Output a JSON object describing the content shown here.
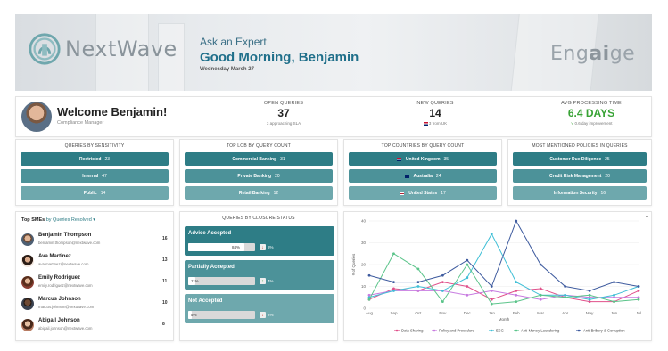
{
  "header": {
    "logo_text": "NextWave",
    "ask_label": "Ask an Expert",
    "greeting": "Good Morning, Benjamin",
    "date": "Wednesday March 27",
    "brand_right_pre": "Eng",
    "brand_right_ai": "ai",
    "brand_right_post": "ge"
  },
  "welcome": {
    "title": "Welcome Benjamin!",
    "role": "Compliance Manager"
  },
  "kpis": {
    "open": {
      "label": "OPEN QUERIES",
      "value": "37",
      "sub": "3 approaching SLA"
    },
    "new": {
      "label": "NEW QUERIES",
      "value": "14",
      "sub": "3 from UK"
    },
    "avg": {
      "label": "AVG PROCESSING TIME",
      "value": "6.4 DAYS",
      "sub": "0.6 day improvement"
    }
  },
  "sensitivity": {
    "title": "QUERIES BY SENSITIVITY",
    "items": [
      {
        "label": "Restricted",
        "count": "23"
      },
      {
        "label": "Internal",
        "count": "47"
      },
      {
        "label": "Public",
        "count": "14"
      }
    ]
  },
  "lob": {
    "title": "TOP LOB BY QUERY COUNT",
    "items": [
      {
        "label": "Commercial Banking",
        "count": "31"
      },
      {
        "label": "Private Banking",
        "count": "20"
      },
      {
        "label": "Retail Banking",
        "count": "12"
      }
    ]
  },
  "countries": {
    "title": "TOP COUNTRIES BY QUERY COUNT",
    "items": [
      {
        "label": "United Kingdom",
        "count": "35"
      },
      {
        "label": "Australia",
        "count": "24"
      },
      {
        "label": "United States",
        "count": "17"
      }
    ]
  },
  "policies": {
    "title": "MOST MENTIONED POLICIES IN QUERIES",
    "items": [
      {
        "label": "Customer Due Diligence",
        "count": "25"
      },
      {
        "label": "Credit Risk Management",
        "count": "20"
      },
      {
        "label": "Information Security",
        "count": "16"
      }
    ]
  },
  "smes": {
    "title": "Top SMEs",
    "by": "by Queries Resolved",
    "items": [
      {
        "name": "Benjamin Thompson",
        "email": "benjamin.thompson@nextwave.com",
        "count": "16"
      },
      {
        "name": "Ava Martinez",
        "email": "ava.martinez@nextwave.com",
        "count": "13"
      },
      {
        "name": "Emily Rodriguez",
        "email": "emily.rodriguez@nextwave.com",
        "count": "11"
      },
      {
        "name": "Marcus Johnson",
        "email": "marcus.johnson@nextwave.com",
        "count": "10"
      },
      {
        "name": "Abigail Johnson",
        "email": "abigail.johnson@nextwave.com",
        "count": "8"
      }
    ]
  },
  "closure": {
    "title": "QUERIES BY CLOSURE STATUS",
    "items": [
      {
        "label": "Advice Accepted",
        "percent": 84,
        "percent_text": "84%",
        "change": "8%"
      },
      {
        "label": "Partially Accepted",
        "percent": 11,
        "percent_text": "11%",
        "change": "4%"
      },
      {
        "label": "Not Accepted",
        "percent": 5,
        "percent_text": "5%",
        "change": "2%"
      }
    ]
  },
  "colors": {
    "teal_dark": "#2e7d86",
    "teal_mid": "#4c9299",
    "teal_light": "#6ea8ad",
    "green": "#39a336"
  },
  "chart_data": {
    "type": "line",
    "xlabel": "Month",
    "ylabel": "# of Queries",
    "ylim": [
      0,
      40
    ],
    "yticks": [
      0,
      10,
      20,
      30,
      40
    ],
    "categories": [
      "Aug",
      "Sep",
      "Oct",
      "Nov",
      "Dec",
      "Jan",
      "Feb",
      "Mar",
      "Apr",
      "May",
      "Jun",
      "Jul"
    ],
    "grid": true,
    "legend_position": "bottom",
    "series": [
      {
        "name": "Data Sharing",
        "color": "#e0508a",
        "values": [
          4,
          9,
          8,
          12,
          10,
          4,
          8,
          9,
          5,
          3,
          3,
          8
        ]
      },
      {
        "name": "Policy and Procedure",
        "color": "#c77be0",
        "values": [
          6,
          8,
          8,
          8,
          6,
          8,
          6,
          4,
          6,
          5,
          5,
          5
        ]
      },
      {
        "name": "ESG",
        "color": "#3fbfd6",
        "values": [
          5,
          8,
          10,
          8,
          14,
          34,
          12,
          6,
          6,
          4,
          6,
          10
        ]
      },
      {
        "name": "Anti-Money Laundering",
        "color": "#5bc48a",
        "values": [
          4,
          25,
          18,
          3,
          20,
          2,
          3,
          6,
          5,
          6,
          3,
          4
        ]
      },
      {
        "name": "Anti-Bribery & Corruption",
        "color": "#3d5a9e",
        "values": [
          15,
          12,
          12,
          15,
          22,
          10,
          40,
          20,
          10,
          8,
          12,
          10
        ]
      }
    ]
  }
}
